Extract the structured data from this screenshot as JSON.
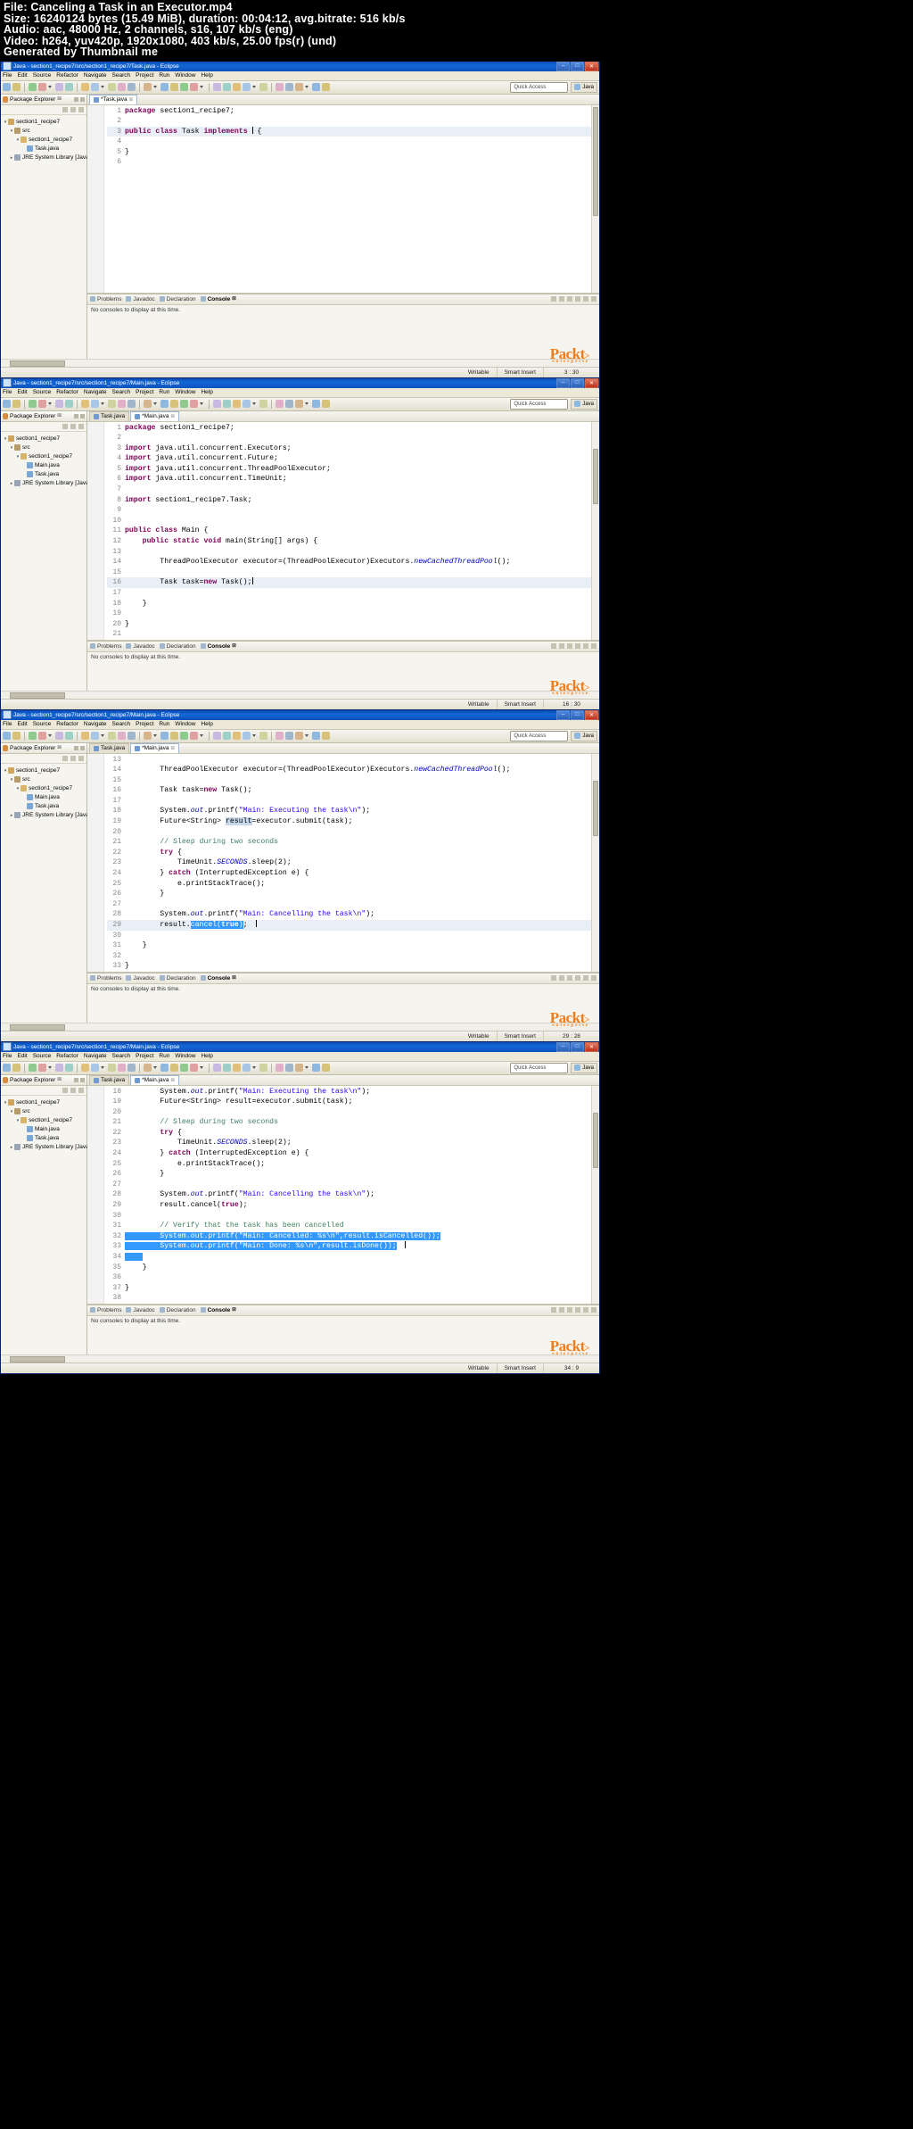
{
  "header": {
    "line1_label": "File:",
    "line1_value": "Canceling a Task in an Executor.mp4",
    "line2": "Size: 16240124 bytes (15.49 MiB), duration: 00:04:12, avg.bitrate: 516 kb/s",
    "line3": "Audio: aac, 48000 Hz, 2 channels, s16, 107 kb/s (eng)",
    "line4": "Video: h264, yuv420p, 1920x1080, 403 kb/s, 25.00 fps(r) (und)",
    "line5": "Generated by Thumbnail me"
  },
  "eclipse": {
    "menu": [
      "File",
      "Edit",
      "Source",
      "Refactor",
      "Navigate",
      "Search",
      "Project",
      "Run",
      "Window",
      "Help"
    ],
    "quick_access_placeholder": "Quick Access",
    "perspective_label": "Java",
    "package_explorer_title": "Package Explorer",
    "window_buttons": {
      "minimize": "–",
      "maximize": "□",
      "close": "✕"
    },
    "console_tabs": [
      "Problems",
      "Javadoc",
      "Declaration",
      "Console"
    ],
    "console_empty_text": "No consoles to display at this time.",
    "status_writable": "Writable",
    "status_insert": "Smart Insert",
    "packt_logo": "Packt",
    "packt_sub": "enterprise"
  },
  "shots": [
    {
      "title": "Java - section1_recipe7/src/section1_recipe7/Task.java - Eclipse",
      "tree": [
        {
          "depth": 0,
          "label": "section1_recipe7",
          "icon": "project-icon",
          "arrow": "▾"
        },
        {
          "depth": 1,
          "label": "src",
          "icon": "source-folder-icon",
          "arrow": "▾"
        },
        {
          "depth": 2,
          "label": "section1_recipe7",
          "icon": "package-icon",
          "arrow": "▾"
        },
        {
          "depth": 3,
          "label": "Task.java",
          "icon": "java-file-icon",
          "arrow": ""
        },
        {
          "depth": 1,
          "label": "JRE System Library [Java",
          "icon": "library-icon",
          "arrow": "▸"
        }
      ],
      "tabs": [
        {
          "label": "*Task.java",
          "selected": true
        }
      ],
      "lines": [
        {
          "n": "1",
          "html": "<span class='kw'>package</span> section1_recipe7;"
        },
        {
          "n": "2",
          "html": ""
        },
        {
          "n": "3",
          "html": "<span class='kw'>public</span> <span class='kw'>class</span> Task <span class='kw'>implements</span> <span class='caret'></span> {",
          "hl": true
        },
        {
          "n": "4",
          "html": ""
        },
        {
          "n": "5",
          "html": "}"
        },
        {
          "n": "6",
          "html": ""
        }
      ],
      "status": {
        "col1": "Writable",
        "col2": "Smart Insert",
        "col3": "3 : 30"
      }
    },
    {
      "title": "Java - section1_recipe7/src/section1_recipe7/Main.java - Eclipse",
      "tree": [
        {
          "depth": 0,
          "label": "section1_recipe7",
          "icon": "project-icon",
          "arrow": "▾"
        },
        {
          "depth": 1,
          "label": "src",
          "icon": "source-folder-icon",
          "arrow": "▾"
        },
        {
          "depth": 2,
          "label": "section1_recipe7",
          "icon": "package-icon",
          "arrow": "▾"
        },
        {
          "depth": 3,
          "label": "Main.java",
          "icon": "java-file-icon",
          "arrow": ""
        },
        {
          "depth": 3,
          "label": "Task.java",
          "icon": "java-file-icon",
          "arrow": ""
        },
        {
          "depth": 1,
          "label": "JRE System Library [Java",
          "icon": "library-icon",
          "arrow": "▸"
        }
      ],
      "tabs": [
        {
          "label": "Task.java",
          "selected": false
        },
        {
          "label": "*Main.java",
          "selected": true
        }
      ],
      "lines": [
        {
          "n": "1",
          "html": "<span class='kw'>package</span> section1_recipe7;"
        },
        {
          "n": "2",
          "html": ""
        },
        {
          "n": "3",
          "html": "<span class='kw'>import</span> java.util.concurrent.Executors;"
        },
        {
          "n": "4",
          "html": "<span class='kw'>import</span> java.util.concurrent.Future;"
        },
        {
          "n": "5",
          "html": "<span class='kw'>import</span> java.util.concurrent.ThreadPoolExecutor;"
        },
        {
          "n": "6",
          "html": "<span class='kw'>import</span> java.util.concurrent.TimeUnit;"
        },
        {
          "n": "7",
          "html": ""
        },
        {
          "n": "8",
          "html": "<span class='kw'>import</span> section1_recipe7.Task;"
        },
        {
          "n": "9",
          "html": ""
        },
        {
          "n": "10",
          "html": ""
        },
        {
          "n": "11",
          "html": "<span class='kw'>public</span> <span class='kw'>class</span> Main {"
        },
        {
          "n": "12",
          "html": "    <span class='kw'>public</span> <span class='kw'>static</span> <span class='kw'>void</span> main(String[] args) {"
        },
        {
          "n": "13",
          "html": ""
        },
        {
          "n": "14",
          "html": "        ThreadPoolExecutor executor=(ThreadPoolExecutor)Executors.<span class='it'>newCachedThreadPool</span>();"
        },
        {
          "n": "15",
          "html": ""
        },
        {
          "n": "16",
          "html": "        Task task=<span class='kw'>new</span> Task();<span class='caret'></span>",
          "hl": true
        },
        {
          "n": "17",
          "html": ""
        },
        {
          "n": "18",
          "html": "    }"
        },
        {
          "n": "19",
          "html": ""
        },
        {
          "n": "20",
          "html": "}"
        },
        {
          "n": "21",
          "html": ""
        }
      ],
      "status": {
        "col1": "Writable",
        "col2": "Smart Insert",
        "col3": "16 : 30"
      }
    },
    {
      "title": "Java - section1_recipe7/src/section1_recipe7/Main.java - Eclipse",
      "tree": [
        {
          "depth": 0,
          "label": "section1_recipe7",
          "icon": "project-icon",
          "arrow": "▾"
        },
        {
          "depth": 1,
          "label": "src",
          "icon": "source-folder-icon",
          "arrow": "▾"
        },
        {
          "depth": 2,
          "label": "section1_recipe7",
          "icon": "package-icon",
          "arrow": "▾"
        },
        {
          "depth": 3,
          "label": "Main.java",
          "icon": "java-file-icon",
          "arrow": ""
        },
        {
          "depth": 3,
          "label": "Task.java",
          "icon": "java-file-icon",
          "arrow": ""
        },
        {
          "depth": 1,
          "label": "JRE System Library [Java",
          "icon": "library-icon",
          "arrow": "▸"
        }
      ],
      "tabs": [
        {
          "label": "Task.java",
          "selected": false
        },
        {
          "label": "*Main.java",
          "selected": true
        }
      ],
      "lines": [
        {
          "n": "13",
          "html": ""
        },
        {
          "n": "14",
          "html": "        ThreadPoolExecutor executor=(ThreadPoolExecutor)Executors.<span class='it'>newCachedThreadPool</span>();"
        },
        {
          "n": "15",
          "html": ""
        },
        {
          "n": "16",
          "html": "        Task task=<span class='kw'>new</span> Task();"
        },
        {
          "n": "17",
          "html": ""
        },
        {
          "n": "18",
          "html": "        System.<span class='fld'>out</span>.printf(<span class='st'>\"Main: Executing the task\\n\"</span>);"
        },
        {
          "n": "19",
          "html": "        Future&lt;String&gt; <span class='sel-box'>result</span>=executor.submit(task);"
        },
        {
          "n": "20",
          "html": ""
        },
        {
          "n": "21",
          "html": "        <span class='cm'>// Sleep during two seconds</span>"
        },
        {
          "n": "22",
          "html": "        <span class='kw'>try</span> {"
        },
        {
          "n": "23",
          "html": "            TimeUnit.<span class='fld'>SECONDS</span>.sleep(2);"
        },
        {
          "n": "24",
          "html": "        } <span class='kw'>catch</span> (InterruptedException e) {"
        },
        {
          "n": "25",
          "html": "            e.printStackTrace();"
        },
        {
          "n": "26",
          "html": "        }"
        },
        {
          "n": "27",
          "html": ""
        },
        {
          "n": "28",
          "html": "        System.<span class='fld'>out</span>.printf(<span class='st'>\"Main: Cancelling the task\\n\"</span>);"
        },
        {
          "n": "29",
          "html": "        result.<span class='sel-blue'>cancel(</span><span class='sel-blue kw' style='color:#fff'>true</span><span class='sel-blue'>)</span>;  <span class='caret'></span>",
          "hl": true
        },
        {
          "n": "30",
          "html": ""
        },
        {
          "n": "31",
          "html": "    }"
        },
        {
          "n": "32",
          "html": ""
        },
        {
          "n": "33",
          "html": "}"
        }
      ],
      "status": {
        "col1": "Writable",
        "col2": "Smart Insert",
        "col3": "29 : 28"
      }
    },
    {
      "title": "Java - section1_recipe7/src/section1_recipe7/Main.java - Eclipse",
      "tree": [
        {
          "depth": 0,
          "label": "section1_recipe7",
          "icon": "project-icon",
          "arrow": "▾"
        },
        {
          "depth": 1,
          "label": "src",
          "icon": "source-folder-icon",
          "arrow": "▾"
        },
        {
          "depth": 2,
          "label": "section1_recipe7",
          "icon": "package-icon",
          "arrow": "▾"
        },
        {
          "depth": 3,
          "label": "Main.java",
          "icon": "java-file-icon",
          "arrow": ""
        },
        {
          "depth": 3,
          "label": "Task.java",
          "icon": "java-file-icon",
          "arrow": ""
        },
        {
          "depth": 1,
          "label": "JRE System Library [Java",
          "icon": "library-icon",
          "arrow": "▸"
        }
      ],
      "tabs": [
        {
          "label": "Task.java",
          "selected": false
        },
        {
          "label": "*Main.java",
          "selected": true
        }
      ],
      "lines": [
        {
          "n": "18",
          "html": "        System.<span class='fld'>out</span>.printf(<span class='st'>\"Main: Executing the task\\n\"</span>);"
        },
        {
          "n": "19",
          "html": "        Future&lt;String&gt; result=executor.submit(task);"
        },
        {
          "n": "20",
          "html": ""
        },
        {
          "n": "21",
          "html": "        <span class='cm'>// Sleep during two seconds</span>"
        },
        {
          "n": "22",
          "html": "        <span class='kw'>try</span> {"
        },
        {
          "n": "23",
          "html": "            TimeUnit.<span class='fld'>SECONDS</span>.sleep(2);"
        },
        {
          "n": "24",
          "html": "        } <span class='kw'>catch</span> (InterruptedException e) {"
        },
        {
          "n": "25",
          "html": "            e.printStackTrace();"
        },
        {
          "n": "26",
          "html": "        }"
        },
        {
          "n": "27",
          "html": ""
        },
        {
          "n": "28",
          "html": "        System.<span class='fld'>out</span>.printf(<span class='st'>\"Main: Cancelling the task\\n\"</span>);"
        },
        {
          "n": "29",
          "html": "        result.cancel(<span class='kw'>true</span>);"
        },
        {
          "n": "30",
          "html": ""
        },
        {
          "n": "31",
          "html": "        <span class='cm'>// Verify that the task has been cancelled</span>"
        },
        {
          "n": "32",
          "html": "<span class='sel-blue'>        System.out.printf(\"Main: Cancelled: %s\\n\",result.isCancelled());</span>",
          "full": true
        },
        {
          "n": "33",
          "html": "<span class='sel-blue'>        System.out.printf(\"Main: Done: %s\\n\",result.isDone());</span>  <span class='caret'></span>",
          "full": true
        },
        {
          "n": "34",
          "html": "<span class='sel-blue'>    </span>"
        },
        {
          "n": "35",
          "html": "    }"
        },
        {
          "n": "36",
          "html": ""
        },
        {
          "n": "37",
          "html": "}"
        },
        {
          "n": "38",
          "html": ""
        }
      ],
      "status": {
        "col1": "Writable",
        "col2": "Smart Insert",
        "col3": "34 : 9"
      }
    }
  ]
}
